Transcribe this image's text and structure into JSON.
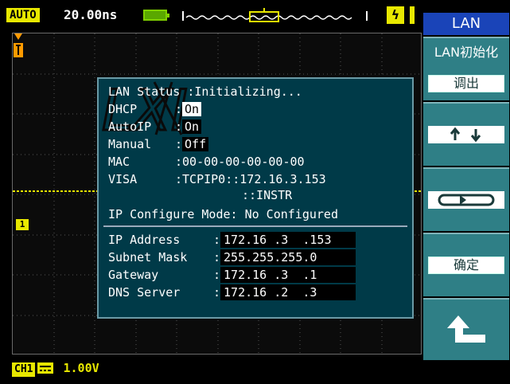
{
  "status_bar": {
    "mode": "AUTO",
    "timebase": "20.00ns",
    "trigger_edge_symbol": "ϟ"
  },
  "channel": {
    "marker": "1",
    "badge": "CH1",
    "volts_per_div": "1.00V",
    "color": "#e8e800"
  },
  "dialog": {
    "status": {
      "label": "LAN Status",
      "value": "Initializing..."
    },
    "dhcp": {
      "label": "DHCP",
      "value": "On"
    },
    "autoip": {
      "label": "AutoIP",
      "value": "On"
    },
    "manual": {
      "label": "Manual",
      "value": "Off"
    },
    "mac": {
      "label": "MAC",
      "value": "00-00-00-00-00-00"
    },
    "visa": {
      "label": "VISA",
      "value_line1": "TCPIP0::172.16.3.153",
      "value_line2": "::INSTR"
    },
    "config_mode": {
      "label": "IP Configure Mode",
      "value": "No Configured"
    },
    "ip_address": {
      "label": "IP Address",
      "value": "172.16 .3  .153"
    },
    "subnet_mask": {
      "label": "Subnet Mask",
      "value": "255.255.255.0"
    },
    "gateway": {
      "label": "Gateway",
      "value": "172.16 .3  .1"
    },
    "dns_server": {
      "label": "DNS Server",
      "value": "172.16 .2  .3"
    },
    "logo_text": "LXI"
  },
  "menu": {
    "title": "LAN",
    "items": [
      {
        "label": "LAN初始化",
        "key": "调出"
      },
      {
        "icon": "up-down-arrows-icon"
      },
      {
        "icon": "toggle-arrows-icon"
      },
      {
        "key": "确定"
      },
      {
        "icon": "return-arrow-icon"
      }
    ]
  }
}
